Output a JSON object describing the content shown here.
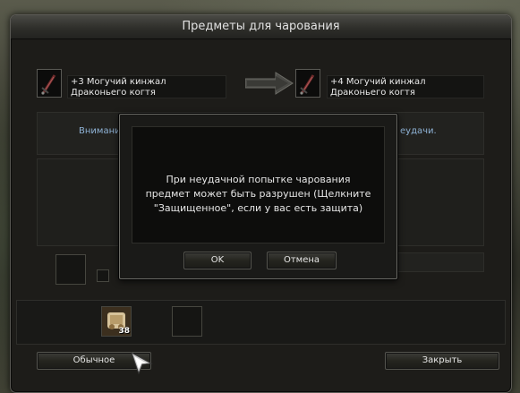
{
  "window": {
    "title": "Предметы для чарования"
  },
  "enchant": {
    "source_item": {
      "name": "+3 Могучий кинжал Драконьего когтя",
      "icon": "dagger-icon"
    },
    "result_item": {
      "name": "+4 Могучий кинжал Драконьего когтя",
      "icon": "dagger-icon"
    },
    "arrow_icon": "arrow-right-icon",
    "notice_left": "Внимани",
    "notice_right": "еудачи."
  },
  "material": {
    "icon": "enchant-scroll-icon",
    "count": "38"
  },
  "buttons": {
    "normal_label": "Обычное",
    "close_label": "Закрыть"
  },
  "dialog": {
    "message_line1": "При неудачной попытке чарования",
    "message_line2": "предмет может быть разрушен (Щелкните",
    "message_line3": "\"Защищенное\", если у вас есть защита)",
    "ok_label": "OK",
    "cancel_label": "Отмена"
  },
  "colors": {
    "info_text": "#8fb3d6",
    "window_bg": "#1d1c19"
  }
}
